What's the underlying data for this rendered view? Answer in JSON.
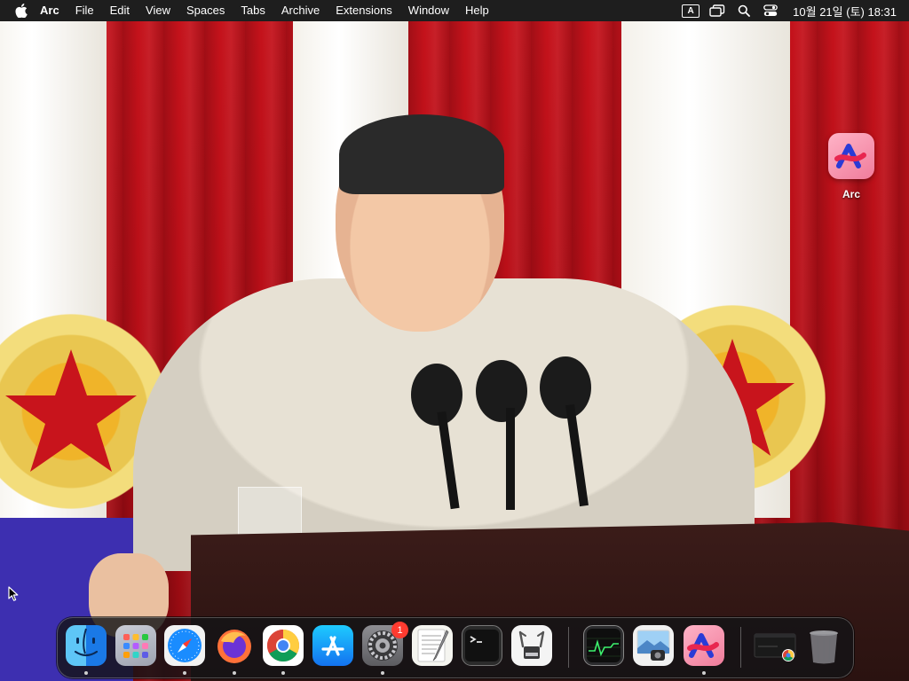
{
  "menubar": {
    "apple_icon": "apple-icon",
    "app_name": "Arc",
    "items": [
      "File",
      "Edit",
      "View",
      "Spaces",
      "Tabs",
      "Archive",
      "Extensions",
      "Window",
      "Help"
    ],
    "status": {
      "input_source": "A",
      "icons": [
        "window-switcher-icon",
        "spotlight-search-icon",
        "control-center-icon"
      ],
      "clock": "10월 21일 (토) 18:31"
    }
  },
  "desktop": {
    "icons": [
      {
        "label": "Arc",
        "icon": "arc-app-icon"
      }
    ]
  },
  "dock": {
    "apps": [
      {
        "name": "Finder",
        "icon": "finder-icon",
        "running": true
      },
      {
        "name": "Launchpad",
        "icon": "launchpad-icon",
        "running": false
      },
      {
        "name": "Safari",
        "icon": "safari-icon",
        "running": true
      },
      {
        "name": "Firefox",
        "icon": "firefox-icon",
        "running": true
      },
      {
        "name": "Google Chrome",
        "icon": "chrome-icon",
        "running": true
      },
      {
        "name": "App Store",
        "icon": "app-store-icon",
        "running": false
      },
      {
        "name": "System Settings",
        "icon": "system-settings-icon",
        "running": true,
        "badge": "1"
      },
      {
        "name": "TextEdit",
        "icon": "textedit-icon",
        "running": false
      },
      {
        "name": "Terminal",
        "icon": "terminal-icon",
        "running": false
      },
      {
        "name": "System Information",
        "icon": "system-information-icon",
        "running": false
      },
      {
        "name": "Activity Monitor",
        "icon": "activity-monitor-icon",
        "running": false
      },
      {
        "name": "Preview",
        "icon": "preview-icon",
        "running": false
      },
      {
        "name": "Arc",
        "icon": "arc-icon",
        "running": true
      },
      {
        "name": "Chrome window",
        "icon": "chrome-window-thumbnail-icon",
        "running": false
      },
      {
        "name": "Trash",
        "icon": "trash-icon",
        "running": false
      }
    ]
  },
  "colors": {
    "menubar_bg": "#1e1e1e",
    "dock_bg": "#141416",
    "badge": "#ff3b30",
    "arc_pink": "#f07c9b",
    "wallpaper_red": "#c4121b"
  }
}
